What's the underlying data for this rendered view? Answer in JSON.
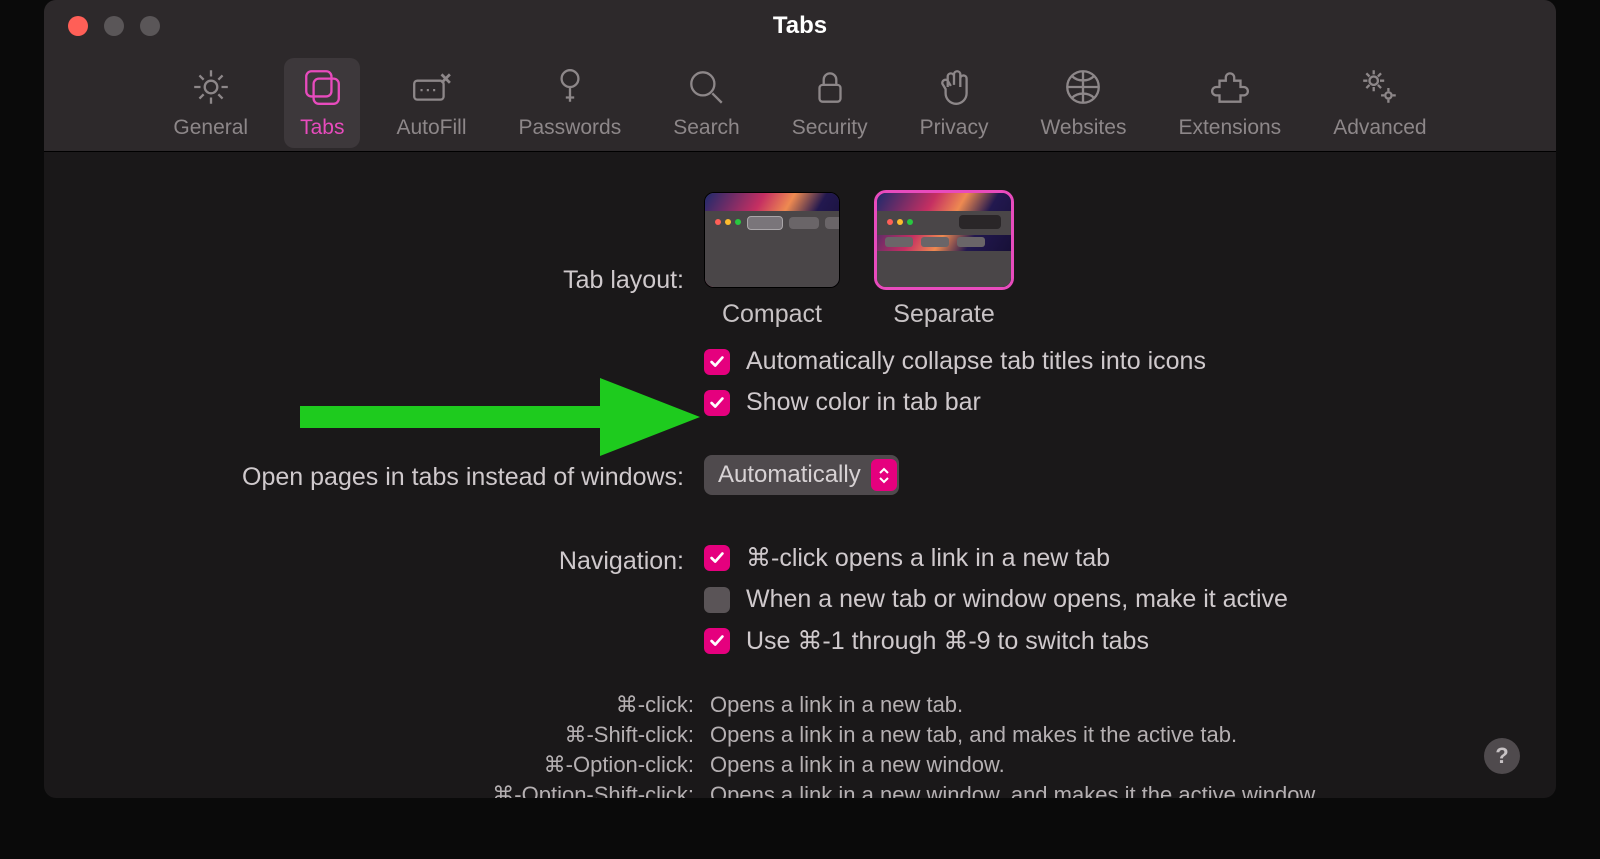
{
  "window": {
    "title": "Tabs"
  },
  "toolbar": {
    "items": [
      {
        "id": "general",
        "label": "General"
      },
      {
        "id": "tabs",
        "label": "Tabs"
      },
      {
        "id": "autofill",
        "label": "AutoFill"
      },
      {
        "id": "passwords",
        "label": "Passwords"
      },
      {
        "id": "search",
        "label": "Search"
      },
      {
        "id": "security",
        "label": "Security"
      },
      {
        "id": "privacy",
        "label": "Privacy"
      },
      {
        "id": "websites",
        "label": "Websites"
      },
      {
        "id": "extensions",
        "label": "Extensions"
      },
      {
        "id": "advanced",
        "label": "Advanced"
      }
    ],
    "selected": "tabs"
  },
  "tabLayout": {
    "label": "Tab layout:",
    "options": [
      {
        "id": "compact",
        "label": "Compact",
        "selected": false
      },
      {
        "id": "separate",
        "label": "Separate",
        "selected": true
      }
    ]
  },
  "layoutChecks": [
    {
      "id": "collapse",
      "label": "Automatically collapse tab titles into icons",
      "checked": true
    },
    {
      "id": "color",
      "label": "Show color in tab bar",
      "checked": true
    }
  ],
  "openPages": {
    "label": "Open pages in tabs instead of windows:",
    "value": "Automatically"
  },
  "navigation": {
    "label": "Navigation:",
    "checks": [
      {
        "id": "cmdclick",
        "label": "⌘-click opens a link in a new tab",
        "checked": true
      },
      {
        "id": "active",
        "label": "When a new tab or window opens, make it active",
        "checked": false
      },
      {
        "id": "cmdnum",
        "label": "Use ⌘-1 through ⌘-9 to switch tabs",
        "checked": true
      }
    ]
  },
  "hints": [
    {
      "k": "⌘-click:",
      "v": "Opens a link in a new tab."
    },
    {
      "k": "⌘-Shift-click:",
      "v": "Opens a link in a new tab, and makes it the active tab."
    },
    {
      "k": "⌘-Option-click:",
      "v": "Opens a link in a new window."
    },
    {
      "k": "⌘-Option-Shift-click:",
      "v": "Opens a link in a new window, and makes it the active window."
    }
  ],
  "help": "?"
}
